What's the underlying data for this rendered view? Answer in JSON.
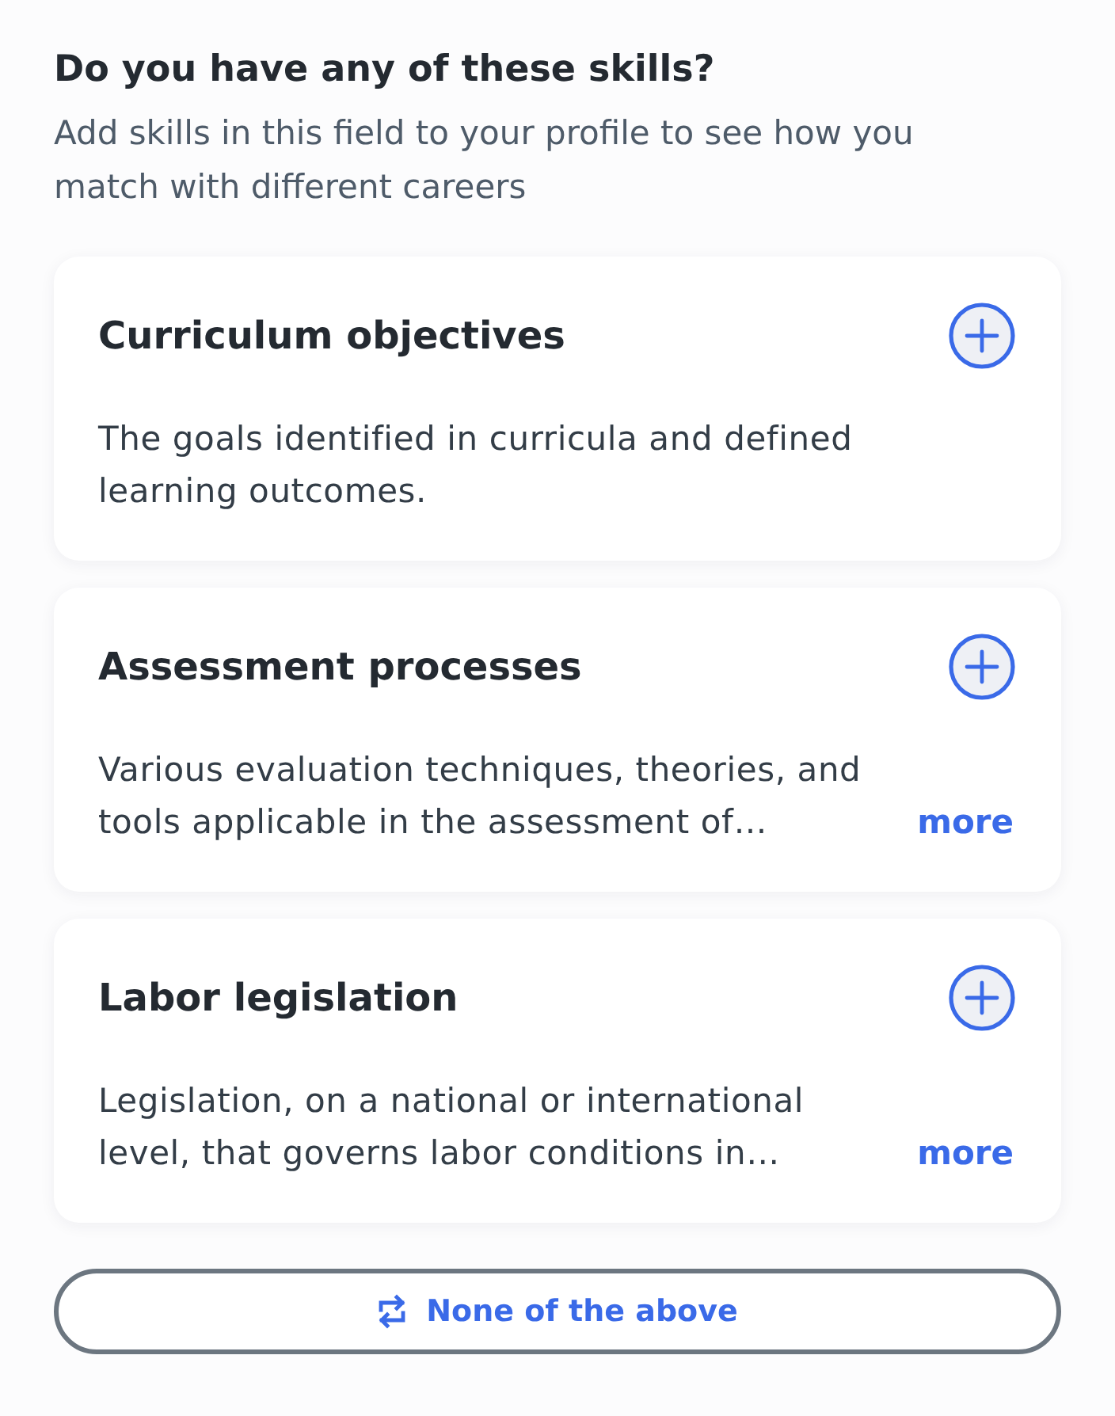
{
  "heading": "Do you have any of these skills?",
  "subheading": "Add skills in this field to your profile to see how you match with different careers",
  "skills": [
    {
      "name": "Curriculum objectives",
      "description": "The goals identified in curricula and defined learning outcomes."
    },
    {
      "name": "Assessment processes",
      "description": "Various evaluation techniques, theories, and tools applicable in the assessment of…",
      "more_link": "more"
    },
    {
      "name": "Labor legislation",
      "description": "Legislation, on a national or international level, that governs labor conditions in…",
      "more_link": "more"
    }
  ],
  "none_button": {
    "label": "None of the above"
  }
}
